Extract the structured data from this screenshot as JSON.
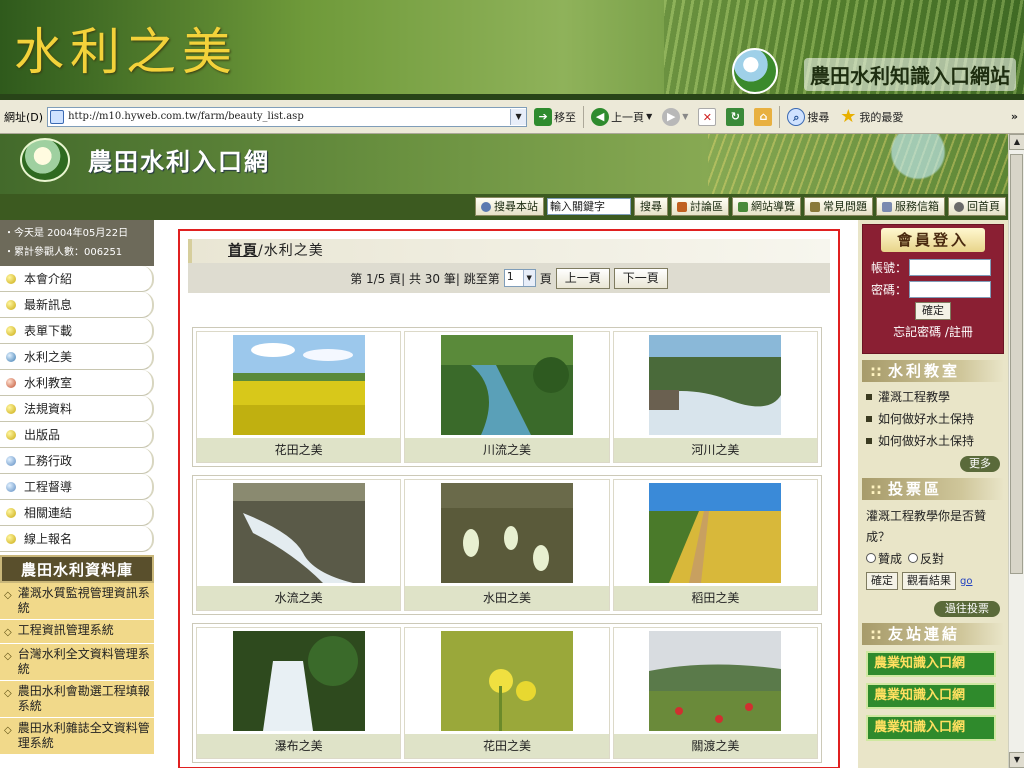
{
  "slide": {
    "title": "水利之美",
    "site_name": "農田水利知識入口網站"
  },
  "browser": {
    "address_label": "網址(D)",
    "url": "http://m10.hyweb.com.tw/farm/beauty_list.asp",
    "go_label": "移至",
    "back_label": "上一頁",
    "search_label": "搜尋",
    "favorites_label": "我的最愛",
    "overflow": "»"
  },
  "site": {
    "title": "農田水利入口網"
  },
  "nav": {
    "search_site": "搜尋本站",
    "keyword_placeholder": "輸入關鍵字",
    "search_button": "搜尋",
    "items": [
      "討論區",
      "網站導覽",
      "常見問題",
      "服務信箱",
      "回首頁"
    ]
  },
  "left": {
    "today": "・今天是 2004年05月22日",
    "visitors": "・累計參觀人數：006251",
    "menu": [
      "本會介紹",
      "最新訊息",
      "表單下載",
      "水利之美",
      "水利教室",
      "法規資料",
      "出版品",
      "工務行政",
      "工程督導",
      "相關連結",
      "線上報名"
    ],
    "db_header": "農田水利資料庫",
    "db_items": [
      "灌溉水質監視管理資訊系統",
      "工程資訊管理系統",
      "台灣水利全文資料管理系統",
      "農田水利會勘選工程填報系統",
      "農田水利雜誌全文資料管理系統"
    ]
  },
  "content": {
    "crumb_home": "首頁",
    "crumb_sep": "/",
    "crumb_current": "水利之美",
    "pager_text": "第 1/5 頁| 共 30 筆| 跳至第",
    "pager_page": "1",
    "pager_unit": "頁",
    "prev_label": "上一頁",
    "next_label": "下一頁",
    "rows": [
      [
        {
          "caption": "花田之美"
        },
        {
          "caption": "川流之美"
        },
        {
          "caption": "河川之美"
        }
      ],
      [
        {
          "caption": "水流之美"
        },
        {
          "caption": "水田之美"
        },
        {
          "caption": "稻田之美"
        }
      ],
      [
        {
          "caption": "瀑布之美"
        },
        {
          "caption": "花田之美"
        },
        {
          "caption": "關渡之美"
        }
      ]
    ]
  },
  "right": {
    "login_title": "會員登入",
    "account_label": "帳號：",
    "password_label": "密碼：",
    "ok_label": "確定",
    "forgot_label": "忘記密碼 /註冊",
    "classroom_title": "水利教室",
    "classroom_items": [
      "灌溉工程教學",
      "如何做好水土保持",
      "如何做好水土保持"
    ],
    "more_label": "更多",
    "vote_title": "投票區",
    "vote_question": "灌溉工程教學你是否贊成？",
    "agree_label": "贊成",
    "oppose_label": "反對",
    "vote_ok": "確定",
    "view_results": "觀看結果",
    "go_link": "go",
    "past_votes": "過往投票",
    "links_title": "友站連結",
    "banner_text": "農業知識入口網"
  }
}
